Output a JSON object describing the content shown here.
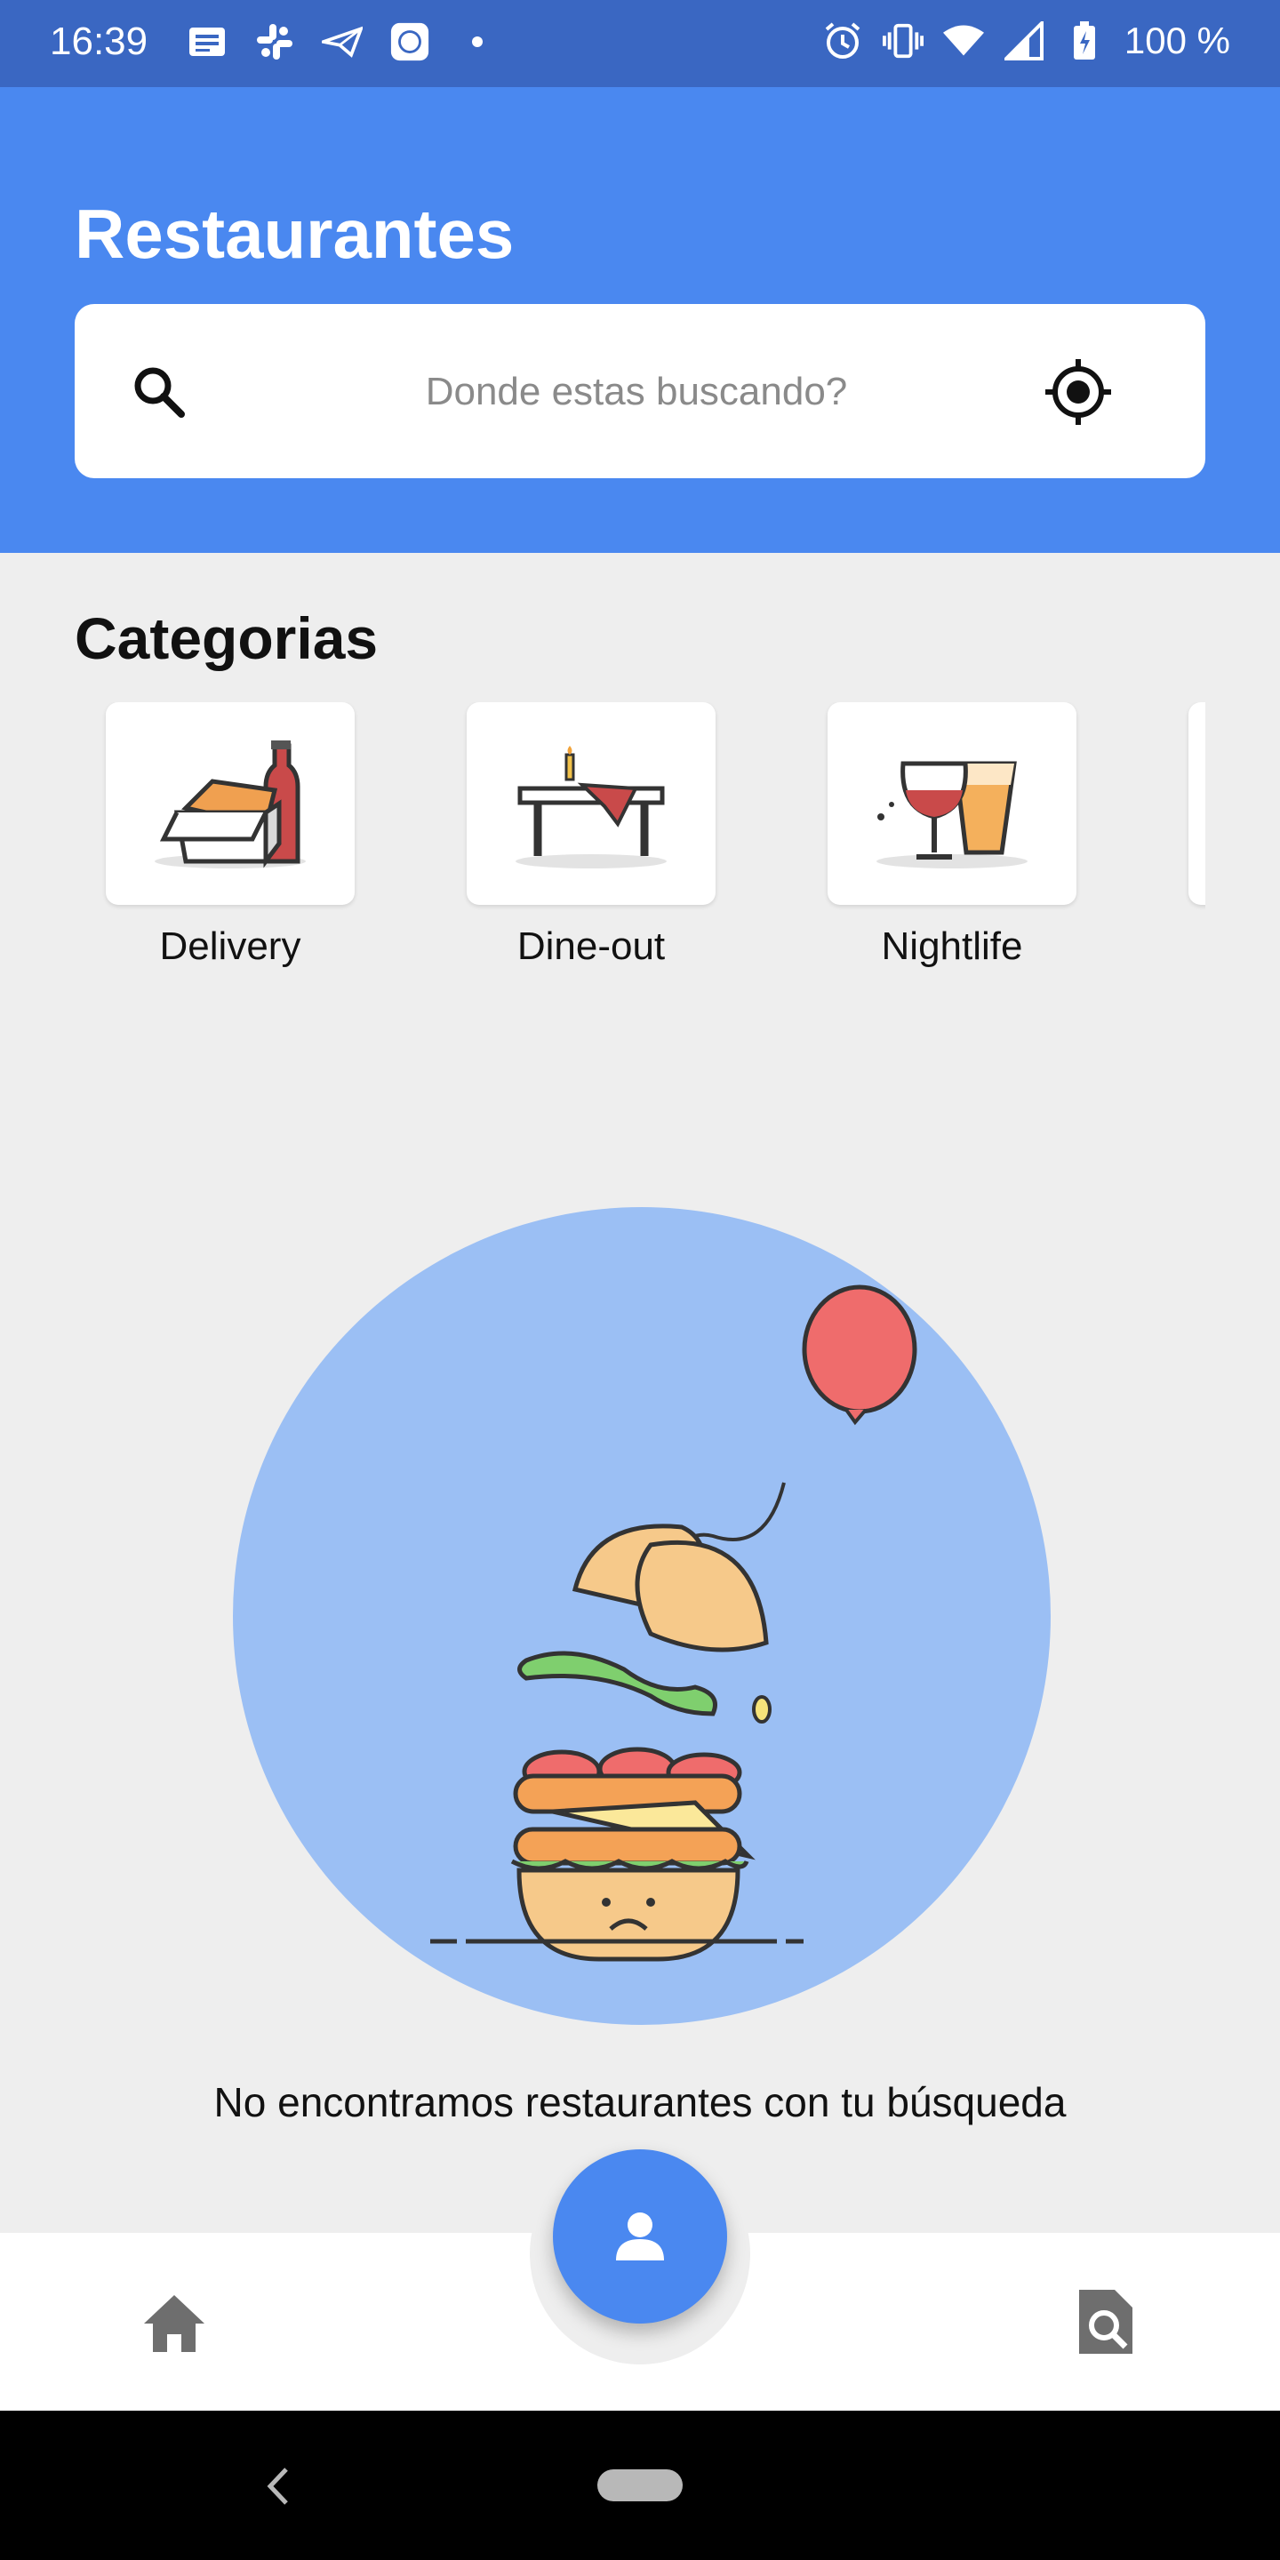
{
  "status_bar": {
    "time": "16:39",
    "battery": "100 %",
    "icons": [
      "news-icon",
      "slack-icon",
      "send-icon",
      "mi-icon",
      "dot-icon",
      "alarm-icon",
      "vibrate-icon",
      "wifi-icon",
      "signal-icon",
      "battery-icon"
    ]
  },
  "header": {
    "title": "Restaurantes",
    "search_placeholder": "Donde estas buscando?",
    "search_value": ""
  },
  "categories": {
    "title": "Categorias",
    "items": [
      {
        "label": "Delivery",
        "icon": "delivery-icon"
      },
      {
        "label": "Dine-out",
        "icon": "dine-out-icon"
      },
      {
        "label": "Nightlife",
        "icon": "nightlife-icon"
      }
    ]
  },
  "empty_state": {
    "message": "No encontramos restaurantes con tu búsqueda",
    "illustration": "sad-burger-balloon"
  },
  "bottom_nav": {
    "items": [
      "home-icon",
      "profile-icon",
      "search-doc-icon"
    ]
  },
  "colors": {
    "primary": "#4a88f0",
    "status_bar": "#3a67c2",
    "background": "#eeeeee"
  }
}
